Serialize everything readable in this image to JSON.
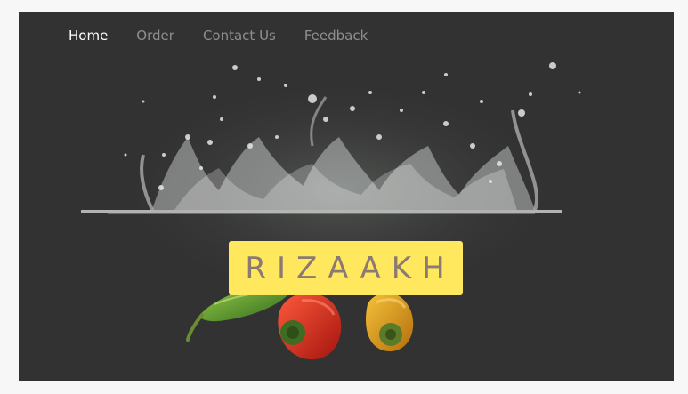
{
  "nav": {
    "items": [
      {
        "label": "Home",
        "active": true
      },
      {
        "label": "Order",
        "active": false
      },
      {
        "label": "Contact Us",
        "active": false
      },
      {
        "label": "Feedback",
        "active": false
      }
    ]
  },
  "hero": {
    "brand_text": "RIZAAKH"
  },
  "colors": {
    "background": "#323232",
    "page": "#f7f7f7",
    "nav_active": "#ffffff",
    "nav_inactive": "#8f8f8f",
    "brand_bg": "#ffe85e",
    "brand_text": "#8a7a72"
  }
}
